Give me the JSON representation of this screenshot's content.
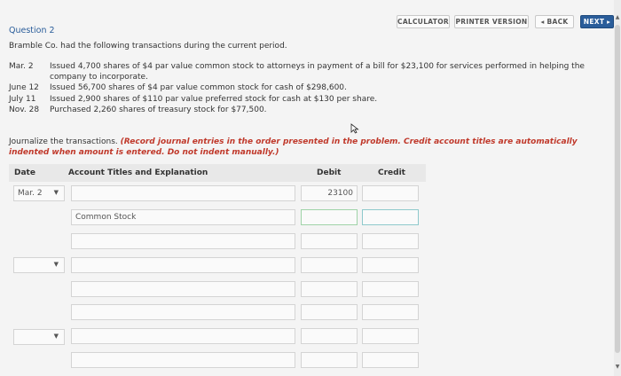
{
  "toolbar": {
    "calculator": "CALCULATOR",
    "printer_version": "PRINTER VERSION",
    "back": "◂ BACK",
    "next": "NEXT ▸"
  },
  "question": {
    "title": "Question 2",
    "intro": "Bramble Co. had the following transactions during the current period.",
    "transactions": [
      {
        "date": "Mar.  2",
        "desc": "Issued 4,700 shares of $4 par value common stock to attorneys in payment of a bill for $23,100 for services performed in helping the company to incorporate."
      },
      {
        "date": "June 12",
        "desc": "Issued 56,700 shares of $4 par value common stock for cash of $298,600."
      },
      {
        "date": "July  11",
        "desc": "Issued 2,900 shares of $110 par value preferred stock for cash at $130 per share."
      },
      {
        "date": "Nov. 28",
        "desc": "Purchased 2,260 shares of treasury stock for $77,500."
      }
    ],
    "instruction_plain": "Journalize the transactions.",
    "instruction_emph": "(Record journal entries in the order presented in the problem. Credit account titles are automatically indented when amount is entered. Do not indent manually.)"
  },
  "table": {
    "headers": {
      "date": "Date",
      "account": "Account Titles and Explanation",
      "debit": "Debit",
      "credit": "Credit"
    },
    "row1": {
      "date": "Mar. 2",
      "account": "",
      "debit": "23100",
      "credit": ""
    },
    "row2": {
      "account": "Common Stock",
      "debit": "",
      "credit": ""
    }
  }
}
